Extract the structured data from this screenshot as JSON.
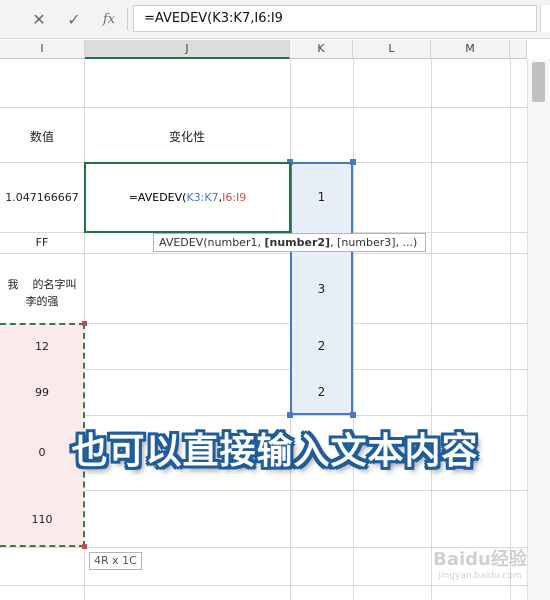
{
  "formula_bar": {
    "cancel_icon": "close-icon",
    "confirm_icon": "check-icon",
    "fx_label": "fx",
    "formula": "=AVEDEV(K3:K7,I6:I9"
  },
  "columns": [
    "I",
    "J",
    "K",
    "L",
    "M"
  ],
  "cells": {
    "i_header": "数值",
    "j_header": "变化性",
    "i_row4": "1.047166667",
    "i_row5": "FF",
    "i_row6_line1": "我    的名字叫",
    "i_row6_line2": "李的强",
    "i_values": [
      "12",
      "99",
      "0",
      "110"
    ],
    "k_values": [
      "1",
      "3",
      "2",
      "2"
    ]
  },
  "edit_cell": {
    "prefix": "=AVEDEV(",
    "ref1": "K3:K7",
    "comma": ",",
    "ref2": "I6:I9",
    "ref1_color": "#4a78c2",
    "ref2_color": "#c0504d"
  },
  "tooltip": {
    "fn": "AVEDEV(number1, ",
    "arg_bold": "[number2]",
    "rest": ", [number3], ...)"
  },
  "selection_size": "4R x 1C",
  "caption": "也可以直接输入文本内容",
  "watermark": {
    "brand": "Baidu经验",
    "url": "jingyan.baidu.com"
  },
  "colors": {
    "accent_green": "#217346",
    "ref_blue": "#4a78c2",
    "ref_red": "#c0504d",
    "caption_outline": "#1f5c9a"
  }
}
